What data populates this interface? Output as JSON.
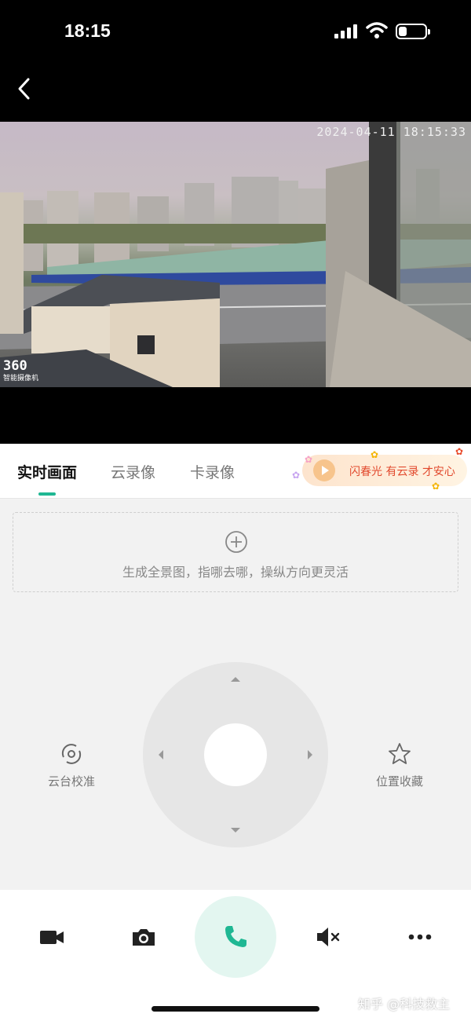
{
  "status_bar": {
    "time": "18:15"
  },
  "feed": {
    "timestamp": "2024-04-11 18:15:33",
    "brand_number": "360",
    "brand_text": "智能摄像机"
  },
  "tabs": [
    {
      "label": "实时画面",
      "active": true
    },
    {
      "label": "云录像",
      "active": false
    },
    {
      "label": "卡录像",
      "active": false
    }
  ],
  "promo": {
    "text": "闪春光 有云录 才安心"
  },
  "panorama": {
    "text": "生成全景图，指哪去哪，操纵方向更灵活"
  },
  "ptz": {
    "calibrate_label": "云台校准",
    "favorite_label": "位置收藏"
  },
  "bottom_bar": {
    "icons": [
      "video-record-icon",
      "camera-icon",
      "phone-icon",
      "mute-icon",
      "more-icon"
    ],
    "accent": "#1fb793"
  },
  "watermark": "知乎 @科技救主"
}
